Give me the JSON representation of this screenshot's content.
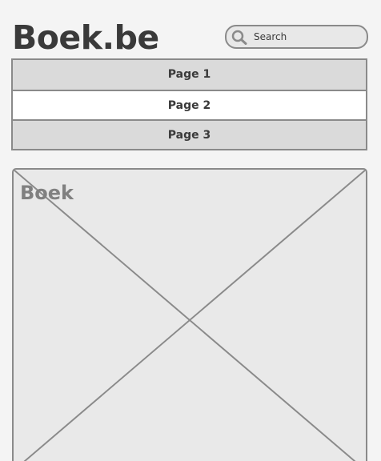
{
  "header": {
    "logo_text": "Boek.be",
    "search": {
      "placeholder": "Search",
      "icon": "search-icon"
    }
  },
  "nav": {
    "items": [
      {
        "label": "Page 1",
        "active": false
      },
      {
        "label": "Page 2",
        "active": true
      },
      {
        "label": "Page 3",
        "active": false
      }
    ]
  },
  "content": {
    "image_placeholder_label": "Boek"
  },
  "colors": {
    "background": "#f4f4f4",
    "text": "#3a3a3a",
    "border": "#8a8a8a",
    "nav_inactive": "#dadada",
    "nav_active": "#ffffff",
    "placeholder_fill": "#e9e9e9"
  }
}
